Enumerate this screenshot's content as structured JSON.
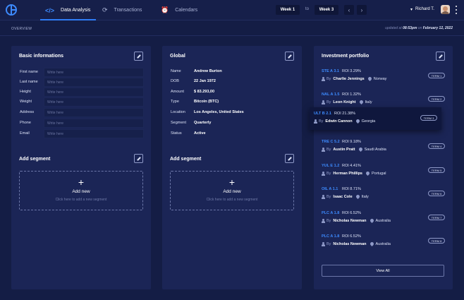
{
  "nav": {
    "tabs": [
      {
        "label": "Data Analysis",
        "icon": "code-icon"
      },
      {
        "label": "Transactions",
        "icon": "refresh-icon"
      },
      {
        "label": "Calendars",
        "icon": "alarm-clock-icon"
      }
    ],
    "week_from": "Week 1",
    "to": "to",
    "week_to": "Week 3",
    "user_name": "Richard T."
  },
  "subbar": {
    "section": "OVERVIEW",
    "updated_prefix": "updated at",
    "updated_time": "08:53pm",
    "updated_on": "on",
    "updated_date": "February 12, 2022"
  },
  "basic": {
    "title": "Basic informations",
    "fields": [
      {
        "label": "First name",
        "placeholder": "Write here"
      },
      {
        "label": "Last name",
        "placeholder": "Write here"
      },
      {
        "label": "Height",
        "placeholder": "Write here"
      },
      {
        "label": "Weight",
        "placeholder": "Write here"
      },
      {
        "label": "Address",
        "placeholder": "Write here"
      },
      {
        "label": "Phone",
        "placeholder": "Write here"
      },
      {
        "label": "Email",
        "placeholder": "Write here"
      }
    ],
    "segment_title": "Add segment",
    "add_new": "Add new",
    "add_hint": "Click here to add a new segment"
  },
  "global": {
    "title": "Global",
    "rows": [
      {
        "label": "Name",
        "value": "Andrew Burton"
      },
      {
        "label": "DOB",
        "value": "22 Jan 1972"
      },
      {
        "label": "Amount",
        "value": "$ 83.293,00"
      },
      {
        "label": "Type",
        "value": "Bitcoin (BTC)"
      },
      {
        "label": "Location",
        "value": "Los Angeles, United States"
      },
      {
        "label": "Segment",
        "value": "Quarterly"
      },
      {
        "label": "Status",
        "value": "Active"
      }
    ],
    "segment_title": "Add segment",
    "add_new": "Add new",
    "add_hint": "Click here to add a new segment"
  },
  "portfolio": {
    "title": "Investment portfolio",
    "by": "By",
    "items": [
      {
        "code": "STE A 3.1",
        "roi": "ROI 3.29%",
        "name": "Charlie Jennings",
        "location": "Norway",
        "term": "TERM 1"
      },
      {
        "code": "NAL A 1.5",
        "roi": "ROI 1.32%",
        "name": "Leon Knight",
        "location": "Italy",
        "term": "TERM 2"
      },
      {
        "code": "ULT B 2.1",
        "roi": "ROI 21.38%",
        "name": "Edwin Cannon",
        "location": "Georgia",
        "term": "TERM 3"
      },
      {
        "code": "TRE C 5.2",
        "roi": "ROI 9.18%",
        "name": "Austin Pratt",
        "location": "Saudi Arabia",
        "term": "TERM 4"
      },
      {
        "code": "YUL E 1.2",
        "roi": "ROI 4.41%",
        "name": "Herman Phillips",
        "location": "Portugal",
        "term": "TERM 5"
      },
      {
        "code": "OIL A 1.1",
        "roi": "ROI 8.71%",
        "name": "Isaac Cole",
        "location": "Italy",
        "term": "TERM 6"
      },
      {
        "code": "PLC A 1.8",
        "roi": "ROI 6.52%",
        "name": "Nicholas Newman",
        "location": "Australia",
        "term": "TERM 7"
      },
      {
        "code": "PLC A 1.8",
        "roi": "ROI 6.52%",
        "name": "Nicholas Newman",
        "location": "Australia",
        "term": "TERM 8"
      }
    ],
    "view_all": "View All"
  },
  "colors": {
    "background": "#141d45",
    "panel": "#1b2556",
    "accent": "#2f7cf6",
    "code_blue": "#3d8bff"
  }
}
